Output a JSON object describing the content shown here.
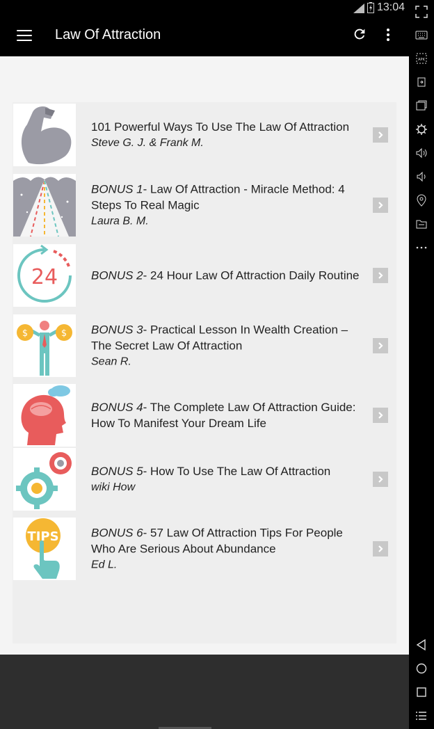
{
  "status_bar": {
    "time": "13:04"
  },
  "app_bar": {
    "title": "Law Of Attraction"
  },
  "books": [
    {
      "prefix": "",
      "title": "101 Powerful Ways To Use The Law Of Attraction",
      "author": "Steve G. J. & Frank M.",
      "icon": "flexed-arm-icon"
    },
    {
      "prefix": "BONUS 1",
      "title": "- Law Of Attraction - Miracle Method: 4 Steps To Real Magic",
      "author": "Laura B. M.",
      "icon": "magic-road-icon"
    },
    {
      "prefix": "BONUS 2",
      "title": "- 24 Hour Law Of Attraction Daily Routine",
      "author": "",
      "icon": "clock-24-icon"
    },
    {
      "prefix": "BONUS 3",
      "title": "- Practical Lesson In Wealth Creation – The Secret Law Of Attraction",
      "author": "Sean R.",
      "icon": "money-bags-man-icon"
    },
    {
      "prefix": "BONUS 4",
      "title": "- The Complete Law Of Attraction Guide: How To Manifest Your Dream Life",
      "author": "",
      "icon": "head-brain-icon"
    },
    {
      "prefix": "BONUS 5",
      "title": "- How To Use The Law Of Attraction",
      "author": "wiki How",
      "icon": "gears-icon"
    },
    {
      "prefix": "BONUS 6",
      "title": "- 57 Law Of Attraction Tips For People Who Are Serious About Abundance",
      "author": "Ed L.",
      "icon": "tips-hand-icon"
    }
  ],
  "tips_badge_text": "TIPS",
  "clock_badge_text": "24",
  "colors": {
    "teal": "#6cc5c0",
    "red": "#e85c5c",
    "gold": "#f5b733",
    "gray_icon": "#9b9ba5"
  }
}
